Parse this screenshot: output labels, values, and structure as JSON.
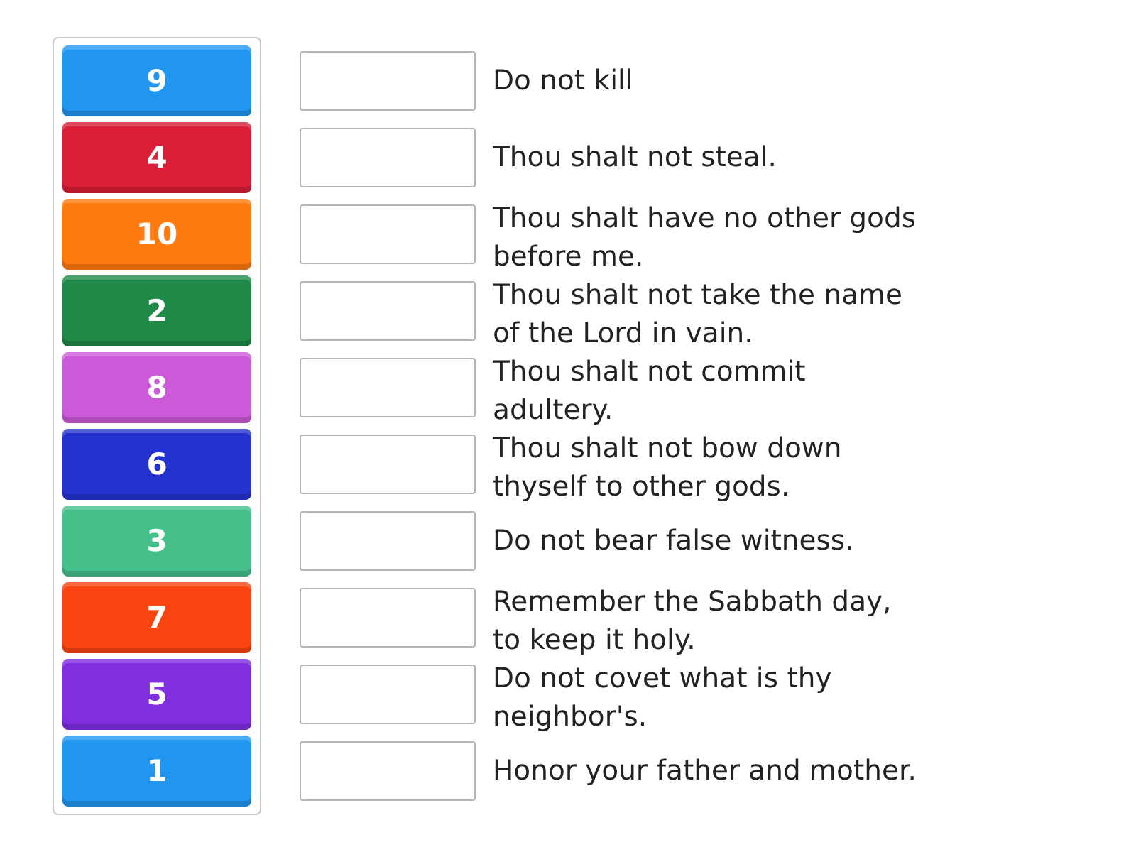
{
  "tiles": [
    {
      "label": "9",
      "color": "#2196f0"
    },
    {
      "label": "4",
      "color": "#d91e36"
    },
    {
      "label": "10",
      "color": "#ff7b0f"
    },
    {
      "label": "2",
      "color": "#1f8a48"
    },
    {
      "label": "8",
      "color": "#cc5ad8"
    },
    {
      "label": "6",
      "color": "#2433d0"
    },
    {
      "label": "3",
      "color": "#45c08a"
    },
    {
      "label": "7",
      "color": "#fa4510"
    },
    {
      "label": "5",
      "color": "#7f2ee0"
    },
    {
      "label": "1",
      "color": "#2196f0"
    }
  ],
  "statements": [
    "Do not kill",
    "Thou shalt not steal.",
    "Thou shalt have no other gods before me.",
    "Thou shalt not take the name of the Lord in vain.",
    "Thou shalt not commit adultery.",
    "Thou shalt not bow down thyself to other gods.",
    "Do not bear false witness.",
    "Remember the Sabbath day, to keep it holy.",
    "Do not covet what is thy neighbor's.",
    "Honor your father and mother."
  ]
}
